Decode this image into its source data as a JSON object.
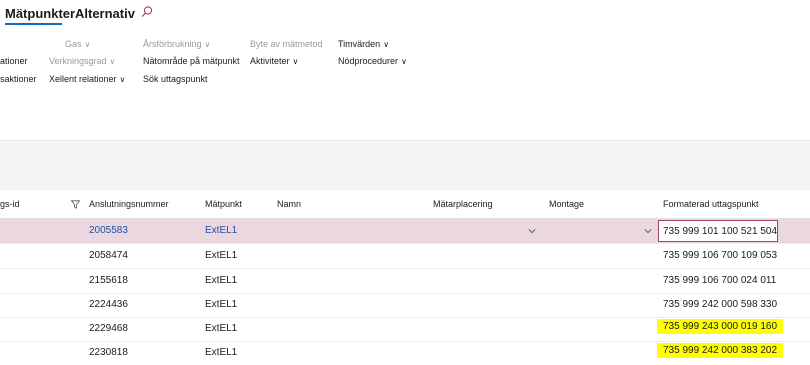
{
  "ribbon": {
    "tabs": [
      {
        "label": "Mätpunkter",
        "active": true
      },
      {
        "label": "Alternativ",
        "active": false
      }
    ],
    "left_partial": [
      "ationer",
      "saktioner"
    ],
    "groups": {
      "col1": [
        {
          "label": "Gas",
          "dim": true,
          "chevron": true
        },
        {
          "label": "Verkningsgrad",
          "dim": true,
          "chevron": true
        },
        {
          "label": "Xellent relationer",
          "dim": false,
          "chevron": true
        }
      ],
      "col2": [
        {
          "label": "Årsförbrukning",
          "dim": true,
          "chevron": true
        },
        {
          "label": "Nätområde på mätpunkt",
          "dim": false,
          "chevron": false
        },
        {
          "label": "Sök uttagspunkt",
          "dim": false,
          "chevron": false
        }
      ],
      "col3": [
        {
          "label": "Byte av mätmetod",
          "dim": true,
          "chevron": false
        },
        {
          "label": "Aktiviteter",
          "dim": false,
          "chevron": true
        }
      ],
      "col4": [
        {
          "label": "Timvärden",
          "dim": false,
          "chevron": true
        },
        {
          "label": "Nödprocedurer",
          "dim": false,
          "chevron": true
        }
      ]
    },
    "chevron_glyph": "∨"
  },
  "grid": {
    "columns": [
      "gs-id",
      "Anslutningsnummer",
      "Mätpunkt",
      "Namn",
      "Mätarplacering",
      "Montage",
      "Formaterad uttagspunkt"
    ],
    "rows": [
      {
        "anslutningsnummer": "2005583",
        "matpunkt": "ExtEL1",
        "uttagspunkt": "735 999 101 100 521 504",
        "selected": true,
        "highlight": false
      },
      {
        "anslutningsnummer": "2058474",
        "matpunkt": "ExtEL1",
        "uttagspunkt": "735 999 106 700 109 053",
        "selected": false,
        "highlight": false
      },
      {
        "anslutningsnummer": "2155618",
        "matpunkt": "ExtEL1",
        "uttagspunkt": "735 999 106 700 024 011",
        "selected": false,
        "highlight": false
      },
      {
        "anslutningsnummer": "2224436",
        "matpunkt": "ExtEL1",
        "uttagspunkt": "735 999 242 000 598 330",
        "selected": false,
        "highlight": false
      },
      {
        "anslutningsnummer": "2229468",
        "matpunkt": "ExtEL1",
        "uttagspunkt": "735 999 243 000 019 160",
        "selected": false,
        "highlight": true
      },
      {
        "anslutningsnummer": "2230818",
        "matpunkt": "ExtEL1",
        "uttagspunkt": "735 999 242 000 383 202",
        "selected": false,
        "highlight": true
      }
    ]
  },
  "colors": {
    "accent": "#0f6cbd",
    "selected_row": "#ead7df",
    "link": "#1e52a8",
    "highlight": "#ffff00"
  }
}
